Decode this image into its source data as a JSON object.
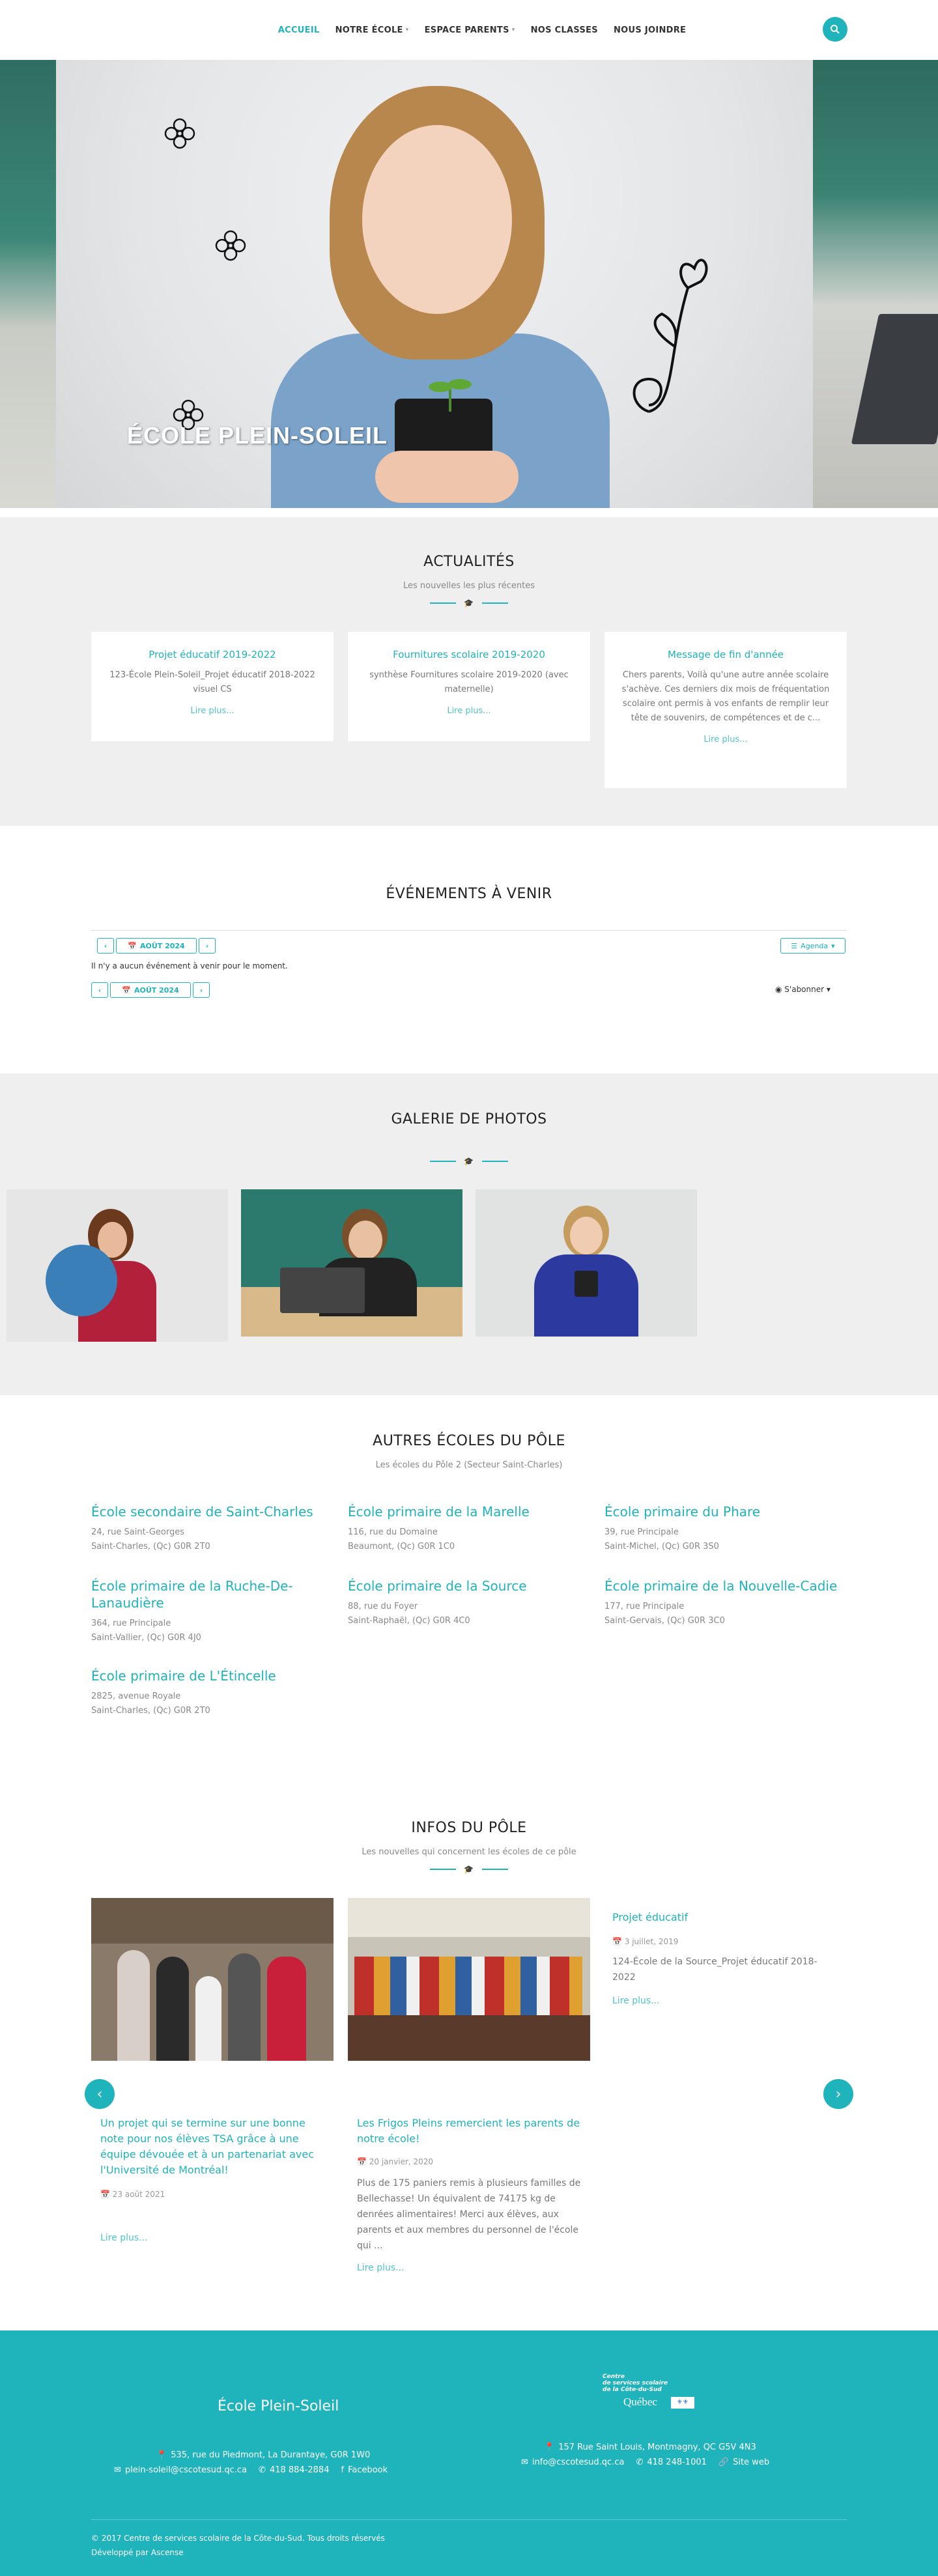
{
  "nav": {
    "items": [
      {
        "label": "ACCUEIL",
        "active": true,
        "dropdown": false
      },
      {
        "label": "NOTRE ÉCOLE",
        "active": false,
        "dropdown": true
      },
      {
        "label": "ESPACE PARENTS",
        "active": false,
        "dropdown": true
      },
      {
        "label": "NOS CLASSES",
        "active": false,
        "dropdown": false
      },
      {
        "label": "NOUS JOINDRE",
        "active": false,
        "dropdown": false
      }
    ],
    "search_icon": "search-icon"
  },
  "hero": {
    "title": "ÉCOLE PLEIN-SOLEIL"
  },
  "news": {
    "title": "ACTUALITÉS",
    "subtitle": "Les nouvelles les plus récentes",
    "cards": [
      {
        "title": "Projet éducatif 2019-2022",
        "text": "123-École Plein-Soleil_Projet éducatif 2018-2022 visuel CS",
        "more": "Lire plus..."
      },
      {
        "title": "Fournitures scolaire 2019-2020",
        "text": "synthèse Fournitures scolaire 2019-2020 (avec maternelle)",
        "more": "Lire plus..."
      },
      {
        "title": "Message de fin d'année",
        "text": "Chers parents, Voilà qu'une autre année scolaire s'achève. Ces derniers dix mois de fréquentation scolaire ont permis à vos enfants de remplir leur tête de souvenirs, de compétences et de c...",
        "more": "Lire plus..."
      }
    ]
  },
  "events": {
    "title": "ÉVÉNEMENTS À VENIR",
    "month": "AOÛT 2024",
    "view_label": "Agenda",
    "empty": "Il n'y a aucun événement à venir pour le moment.",
    "subscribe": "S'abonner"
  },
  "gallery": {
    "title": "GALERIE DE PHOTOS"
  },
  "schools": {
    "title": "AUTRES ÉCOLES DU PÔLE",
    "subtitle": "Les écoles du Pôle 2 (Secteur Saint-Charles)",
    "items": [
      {
        "name": "École secondaire de Saint-Charles",
        "line1": "24, rue Saint-Georges",
        "line2": "Saint-Charles, (Qc) G0R 2T0"
      },
      {
        "name": "École primaire de la Marelle",
        "line1": "116, rue du Domaine",
        "line2": "Beaumont, (Qc) G0R 1C0"
      },
      {
        "name": "École primaire du Phare",
        "line1": "39, rue Principale",
        "line2": "Saint-Michel, (Qc) G0R 3S0"
      },
      {
        "name": "École primaire de la Ruche-De-Lanaudière",
        "line1": "364, rue Principale",
        "line2": "Saint-Vallier, (Qc) G0R 4J0"
      },
      {
        "name": "École primaire de la Source",
        "line1": "88, rue du Foyer",
        "line2": "Saint-Raphaël, (Qc) G0R 4C0"
      },
      {
        "name": "École primaire de la Nouvelle-Cadie",
        "line1": "177, rue Principale",
        "line2": "Saint-Gervais, (Qc) G0R 3C0"
      },
      {
        "name": "École primaire de L'Étincelle",
        "line1": "2825, avenue Royale",
        "line2": "Saint-Charles, (Qc) G0R 2T0"
      }
    ]
  },
  "infos": {
    "title": "INFOS DU PÔLE",
    "subtitle": "Les nouvelles qui concernent les écoles de ce pôle",
    "posts": [
      {
        "title": "Un projet qui se termine sur une bonne note pour nos élèves TSA grâce à une équipe dévouée et à un partenariat avec l'Université de Montréal!",
        "date": "23 août 2021",
        "text": "",
        "more": "Lire plus..."
      },
      {
        "title": "Les Frigos Pleins remercient les parents de notre école!",
        "date": "20 janvier, 2020",
        "text": "Plus de 175 paniers remis à plusieurs familles de Bellechasse! Un équivalent de 74175 kg de denrées alimentaires! Merci aux élèves, aux parents et aux membres du personnel de l'école qui ...",
        "more": "Lire plus..."
      },
      {
        "title": "Projet éducatif",
        "date": "3 juillet, 2019",
        "text": "124-École de la Source_Projet éducatif 2018-2022",
        "more": "Lire plus..."
      }
    ]
  },
  "footer": {
    "school_name": "École Plein-Soleil",
    "address": "535, rue du Piedmont, La Durantaye, G0R 1W0",
    "email": "plein-soleil@cscotesud.qc.ca",
    "phone": "418 884-2884",
    "facebook": "Facebook",
    "logo_line1": "Centre",
    "logo_line2": "de services scolaire",
    "logo_line3": "de la Côte-du-Sud",
    "logo_quebec": "Québec",
    "cs_address": "157 Rue Saint Louis, Montmagny, QC G5V 4N3",
    "cs_email": "info@cscotesud.qc.ca",
    "cs_phone": "418 248-1001",
    "cs_site": "Site web",
    "copyright": "© 2017 Centre de services scolaire de la Côte-du-Sud. Tous droits réservés",
    "credits": "Développé par Ascense"
  },
  "colors": {
    "accent": "#1fb3bb",
    "section_bg": "#efefef"
  }
}
